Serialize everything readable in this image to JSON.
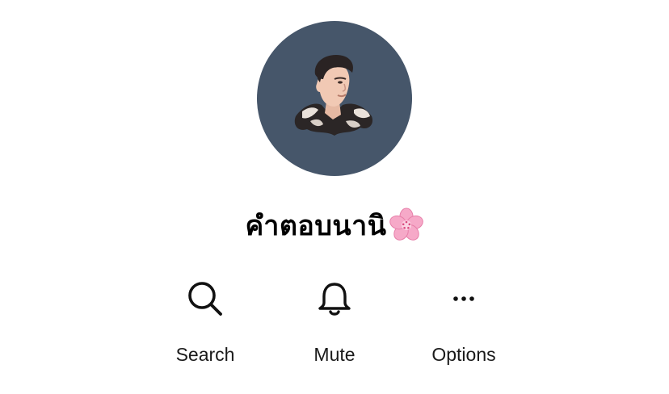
{
  "profile": {
    "display_name": "คำตอบนานิ",
    "name_emoji": "cherry-blossom-icon",
    "avatar_background": "#46566a"
  },
  "actions": [
    {
      "label": "Search",
      "icon": "search-icon"
    },
    {
      "label": "Mute",
      "icon": "bell-icon"
    },
    {
      "label": "Options",
      "icon": "more-horizontal-icon"
    }
  ],
  "colors": {
    "background": "#ffffff",
    "text": "#111111",
    "avatar": "#46566a",
    "blossom": "#f6a9c8"
  }
}
